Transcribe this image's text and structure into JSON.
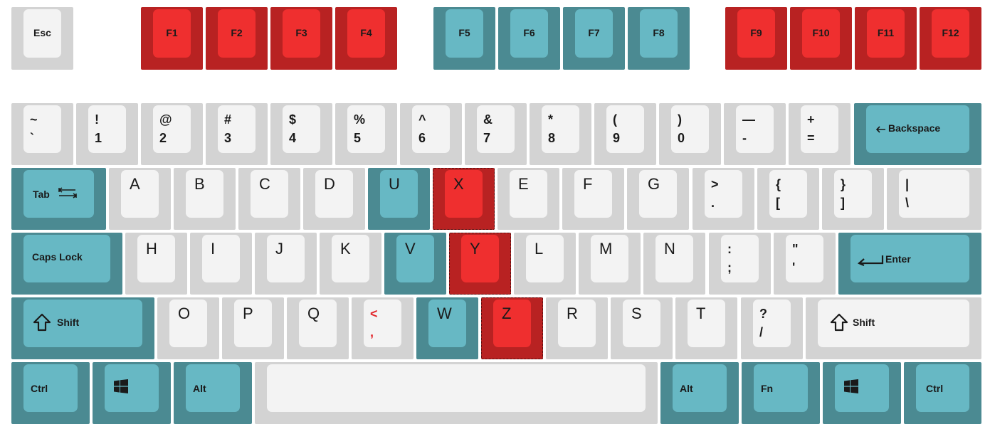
{
  "colors": {
    "gray_base": "#d3d3d3",
    "gray_cap": "#f3f3f3",
    "red_base": "#b82222",
    "red_cap": "#ef2f2f",
    "teal_base": "#4b8a92",
    "teal_cap": "#67b8c4",
    "highlight_legend": "#e2262b"
  },
  "keyboard": {
    "function_row": [
      {
        "label": "Esc",
        "color": "gray"
      },
      {
        "label": "F1",
        "color": "red"
      },
      {
        "label": "F2",
        "color": "red"
      },
      {
        "label": "F3",
        "color": "red"
      },
      {
        "label": "F4",
        "color": "red"
      },
      {
        "label": "F5",
        "color": "teal"
      },
      {
        "label": "F6",
        "color": "teal"
      },
      {
        "label": "F7",
        "color": "teal"
      },
      {
        "label": "F8",
        "color": "teal"
      },
      {
        "label": "F9",
        "color": "red"
      },
      {
        "label": "F10",
        "color": "red"
      },
      {
        "label": "F11",
        "color": "red"
      },
      {
        "label": "F12",
        "color": "red"
      }
    ],
    "number_row": [
      {
        "shift": "~",
        "base": "`"
      },
      {
        "shift": "!",
        "base": "1"
      },
      {
        "shift": "@",
        "base": "2"
      },
      {
        "shift": "#",
        "base": "3"
      },
      {
        "shift": "$",
        "base": "4"
      },
      {
        "shift": "%",
        "base": "5"
      },
      {
        "shift": "^",
        "base": "6"
      },
      {
        "shift": "&",
        "base": "7"
      },
      {
        "shift": "*",
        "base": "8"
      },
      {
        "shift": "(",
        "base": "9"
      },
      {
        "shift": ")",
        "base": "0"
      },
      {
        "shift": "—",
        "base": "-"
      },
      {
        "shift": "+",
        "base": "="
      },
      {
        "label": "Backspace",
        "icon": "left-arrow-icon"
      }
    ],
    "row_tab": [
      {
        "label": "Tab",
        "icon": "tab-arrows-icon"
      },
      {
        "label": "A"
      },
      {
        "label": "B"
      },
      {
        "label": "C"
      },
      {
        "label": "D"
      },
      {
        "label": "U"
      },
      {
        "label": "X"
      },
      {
        "label": "E"
      },
      {
        "label": "F"
      },
      {
        "label": "G"
      },
      {
        "shift": ">",
        "base": "."
      },
      {
        "shift": "{",
        "base": "["
      },
      {
        "shift": "}",
        "base": "]"
      },
      {
        "shift": "|",
        "base": "\\"
      }
    ],
    "row_caps": [
      {
        "label": "Caps Lock"
      },
      {
        "label": "H"
      },
      {
        "label": "I"
      },
      {
        "label": "J"
      },
      {
        "label": "K"
      },
      {
        "label": "V"
      },
      {
        "label": "Y"
      },
      {
        "label": "L"
      },
      {
        "label": "M"
      },
      {
        "label": "N"
      },
      {
        "shift": ":",
        "base": ";"
      },
      {
        "shift": "\"",
        "base": "'"
      },
      {
        "label": "Enter",
        "icon": "return-arrow-icon"
      }
    ],
    "row_shift": [
      {
        "label": "Shift",
        "icon": "shift-arrow-icon"
      },
      {
        "label": "O"
      },
      {
        "label": "P"
      },
      {
        "label": "Q"
      },
      {
        "shift": "<",
        "base": ","
      },
      {
        "label": "W"
      },
      {
        "label": "Z"
      },
      {
        "label": "R"
      },
      {
        "label": "S"
      },
      {
        "label": "T"
      },
      {
        "shift": "?",
        "base": "/"
      },
      {
        "label": "Shift",
        "icon": "shift-arrow-icon"
      }
    ],
    "row_bottom": [
      {
        "label": "Ctrl"
      },
      {
        "icon": "windows-logo-icon"
      },
      {
        "label": "Alt"
      },
      {
        "label": ""
      },
      {
        "label": "Alt"
      },
      {
        "label": "Fn"
      },
      {
        "icon": "windows-logo-icon"
      },
      {
        "label": "Ctrl"
      }
    ]
  }
}
